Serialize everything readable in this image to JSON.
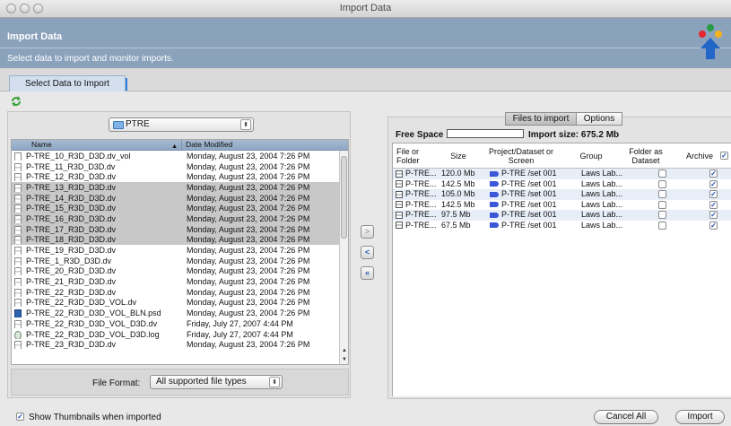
{
  "window": {
    "title": "Import Data"
  },
  "header": {
    "title": "Import Data",
    "subtitle": "Select data to import and monitor imports."
  },
  "tabs": [
    {
      "label": "Select Data to Import"
    }
  ],
  "left": {
    "folder": "PTRE",
    "columns": {
      "name": "Name",
      "date": "Date Modified"
    },
    "files": [
      {
        "name": "P-TRE_10_R3D_D3D.dv_vol",
        "date": "Monday, August 23, 2004 7:26 PM",
        "icon": "doc-icon",
        "selected": false
      },
      {
        "name": "P-TRE_11_R3D_D3D.dv",
        "date": "Monday, August 23, 2004 7:26 PM",
        "icon": "dv-icon",
        "selected": false
      },
      {
        "name": "P-TRE_12_R3D_D3D.dv",
        "date": "Monday, August 23, 2004 7:26 PM",
        "icon": "dv-icon",
        "selected": false
      },
      {
        "name": "P-TRE_13_R3D_D3D.dv",
        "date": "Monday, August 23, 2004 7:26 PM",
        "icon": "dv-icon",
        "selected": true
      },
      {
        "name": "P-TRE_14_R3D_D3D.dv",
        "date": "Monday, August 23, 2004 7:26 PM",
        "icon": "dv-icon",
        "selected": true
      },
      {
        "name": "P-TRE_15_R3D_D3D.dv",
        "date": "Monday, August 23, 2004 7:26 PM",
        "icon": "dv-icon",
        "selected": true
      },
      {
        "name": "P-TRE_16_R3D_D3D.dv",
        "date": "Monday, August 23, 2004 7:26 PM",
        "icon": "dv-icon",
        "selected": true
      },
      {
        "name": "P-TRE_17_R3D_D3D.dv",
        "date": "Monday, August 23, 2004 7:26 PM",
        "icon": "dv-icon",
        "selected": true
      },
      {
        "name": "P-TRE_18_R3D_D3D.dv",
        "date": "Monday, August 23, 2004 7:26 PM",
        "icon": "dv-icon",
        "selected": true
      },
      {
        "name": "P-TRE_19_R3D_D3D.dv",
        "date": "Monday, August 23, 2004 7:26 PM",
        "icon": "dv-icon",
        "selected": false
      },
      {
        "name": "P-TRE_1_R3D_D3D.dv",
        "date": "Monday, August 23, 2004 7:26 PM",
        "icon": "dv-icon",
        "selected": false
      },
      {
        "name": "P-TRE_20_R3D_D3D.dv",
        "date": "Monday, August 23, 2004 7:26 PM",
        "icon": "dv-icon",
        "selected": false
      },
      {
        "name": "P-TRE_21_R3D_D3D.dv",
        "date": "Monday, August 23, 2004 7:26 PM",
        "icon": "dv-icon",
        "selected": false
      },
      {
        "name": "P-TRE_22_R3D_D3D.dv",
        "date": "Monday, August 23, 2004 7:26 PM",
        "icon": "dv-icon",
        "selected": false
      },
      {
        "name": "P-TRE_22_R3D_D3D_VOL.dv",
        "date": "Monday, August 23, 2004 7:26 PM",
        "icon": "dv-icon",
        "selected": false
      },
      {
        "name": "P-TRE_22_R3D_D3D_VOL_BLN.psd",
        "date": "Monday, August 23, 2004 7:26 PM",
        "icon": "psd-icon",
        "selected": false
      },
      {
        "name": "P-TRE_22_R3D_D3D_VOL_D3D.dv",
        "date": "Friday, July 27, 2007 4:44 PM",
        "icon": "dv-icon",
        "selected": false
      },
      {
        "name": "P-TRE_22_R3D_D3D_VOL_D3D.log",
        "date": "Friday, July 27, 2007 4:44 PM",
        "icon": "log-icon",
        "selected": false
      },
      {
        "name": "P-TRE_23_R3D_D3D.dv",
        "date": "Monday, August 23, 2004 7:26 PM",
        "icon": "dv-icon",
        "selected": false
      }
    ],
    "format_label": "File Format:",
    "format_value": "All supported file types"
  },
  "right": {
    "tabs": [
      "Files to import",
      "Options"
    ],
    "free_space_label": "Free Space",
    "import_size_label": "Import size: 675.2 Mb",
    "columns": {
      "file": "File or Folder",
      "size": "Size",
      "project": "Project/Dataset or Screen",
      "group": "Group",
      "folder_as": "Folder as Dataset",
      "archive": "Archive"
    },
    "rows": [
      {
        "file": "P-TRE...",
        "size": "120.0 Mb",
        "project": "P-TRE /set 001",
        "group": "Laws Lab...",
        "folder_as": false,
        "archive": true
      },
      {
        "file": "P-TRE...",
        "size": "142.5 Mb",
        "project": "P-TRE /set 001",
        "group": "Laws Lab...",
        "folder_as": false,
        "archive": true
      },
      {
        "file": "P-TRE...",
        "size": "105.0 Mb",
        "project": "P-TRE /set 001",
        "group": "Laws Lab...",
        "folder_as": false,
        "archive": true
      },
      {
        "file": "P-TRE...",
        "size": "142.5 Mb",
        "project": "P-TRE /set 001",
        "group": "Laws Lab...",
        "folder_as": false,
        "archive": true
      },
      {
        "file": "P-TRE...",
        "size": "97.5 Mb",
        "project": "P-TRE /set 001",
        "group": "Laws Lab...",
        "folder_as": false,
        "archive": true
      },
      {
        "file": "P-TRE...",
        "size": "67.5 Mb",
        "project": "P-TRE /set 001",
        "group": "Laws Lab...",
        "folder_as": false,
        "archive": true
      }
    ]
  },
  "bottom": {
    "show_thumbnails": "Show Thumbnails when imported",
    "cancel_all": "Cancel All",
    "import": "Import"
  },
  "icons": {
    "add": "add-arrow-icon",
    "remove": "remove-arrow-icon",
    "remove_all": "remove-all-icon",
    "refresh": "refresh-icon"
  }
}
